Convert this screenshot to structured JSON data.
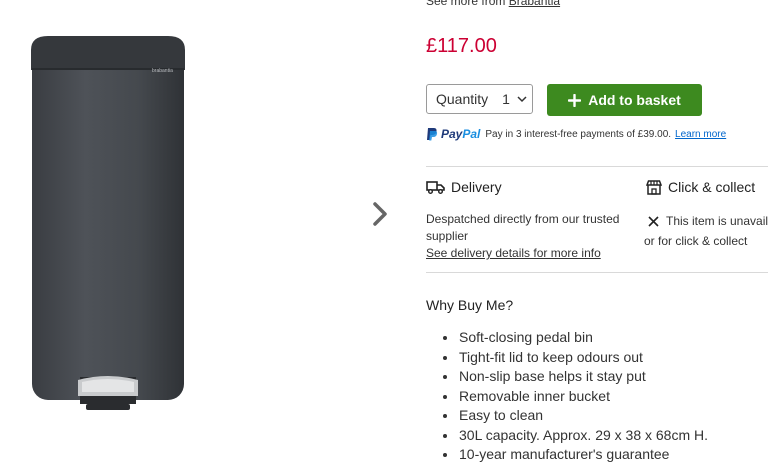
{
  "product": {
    "see_more_prefix": "See more from",
    "see_more_brand": "Brabantia",
    "price": "£117.00",
    "image_brand_label": "brabantia"
  },
  "purchase": {
    "quantity_label": "Quantity",
    "quantity_value": "1",
    "add_to_basket_label": "Add to basket",
    "button_color": "#3d8a1f"
  },
  "paypal": {
    "brand_pay": "Pay",
    "brand_pal": "Pal",
    "text": "Pay in 3 interest-free payments of £39.00.",
    "link": "Learn more"
  },
  "delivery": {
    "title": "Delivery",
    "line1": "Despatched directly from our trusted",
    "line2": "supplier",
    "link": "See delivery details for more info",
    "icon": "truck-icon"
  },
  "collect": {
    "title": "Click & collect",
    "line1": "This item is unavaila",
    "line2": "or for click & collect",
    "icon": "store-icon"
  },
  "why_buy": {
    "title": "Why Buy Me?",
    "bullets": [
      "Soft-closing pedal bin",
      "Tight-fit lid to keep odours out",
      "Non-slip base helps it stay put",
      "Removable inner bucket",
      "Easy to clean",
      "30L capacity. Approx. 29 x 38 x 68cm H.",
      "10-year manufacturer's guarantee"
    ]
  },
  "colors": {
    "price": "#cc0033",
    "link": "#0066cc"
  }
}
